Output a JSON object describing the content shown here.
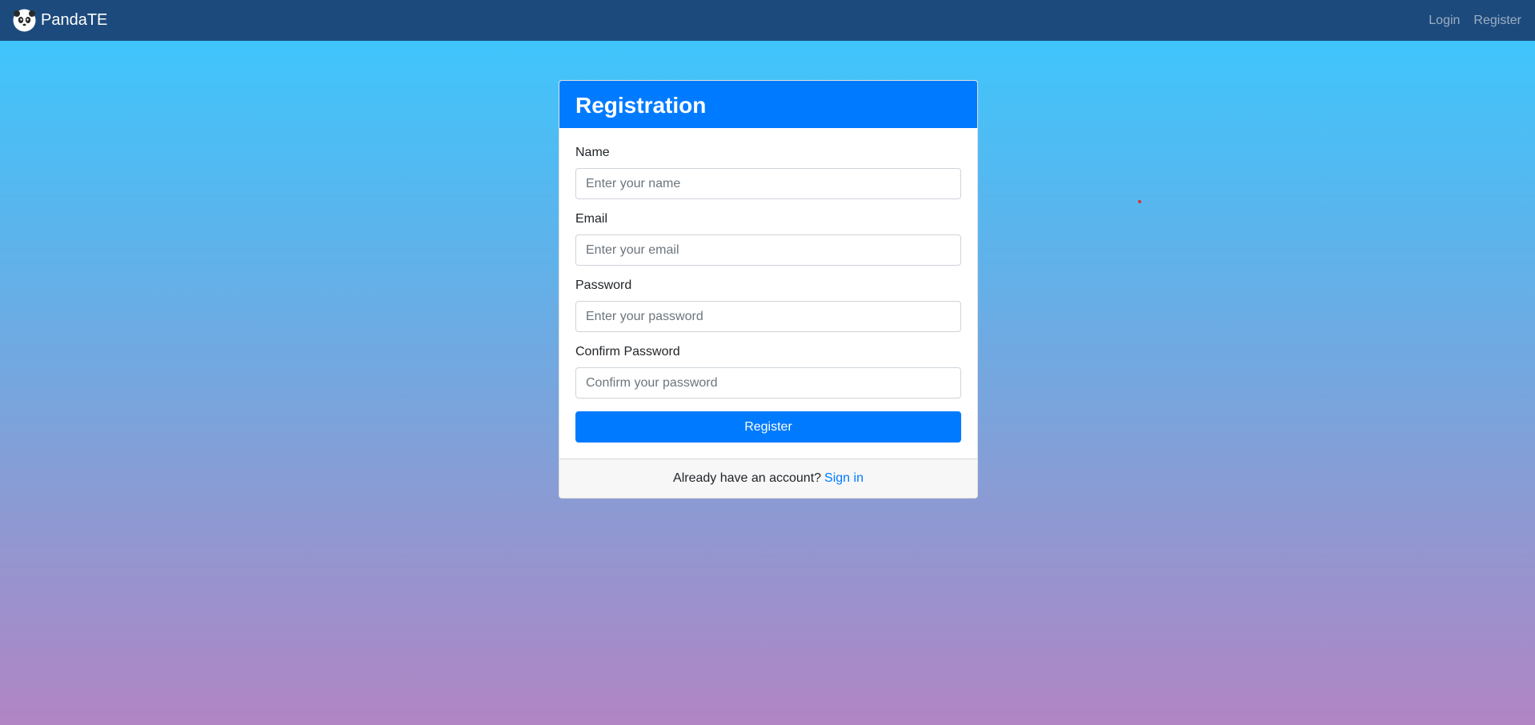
{
  "navbar": {
    "brand_name": "PandaTE",
    "brand_icon": "panda-icon",
    "links": {
      "login": "Login",
      "register": "Register"
    }
  },
  "card": {
    "title": "Registration",
    "fields": {
      "name": {
        "label": "Name",
        "placeholder": "Enter your name",
        "value": ""
      },
      "email": {
        "label": "Email",
        "placeholder": "Enter your email",
        "value": ""
      },
      "password": {
        "label": "Password",
        "placeholder": "Enter your password",
        "value": ""
      },
      "confirm_password": {
        "label": "Confirm Password",
        "placeholder": "Confirm your password",
        "value": ""
      }
    },
    "submit_label": "Register",
    "footer": {
      "text": "Already have an account?",
      "link_text": "Sign in"
    }
  },
  "colors": {
    "navbar_bg": "#1d4a7c",
    "primary": "#007bff",
    "gradient_top": "#39c9ff",
    "gradient_bottom": "#b185c4"
  }
}
